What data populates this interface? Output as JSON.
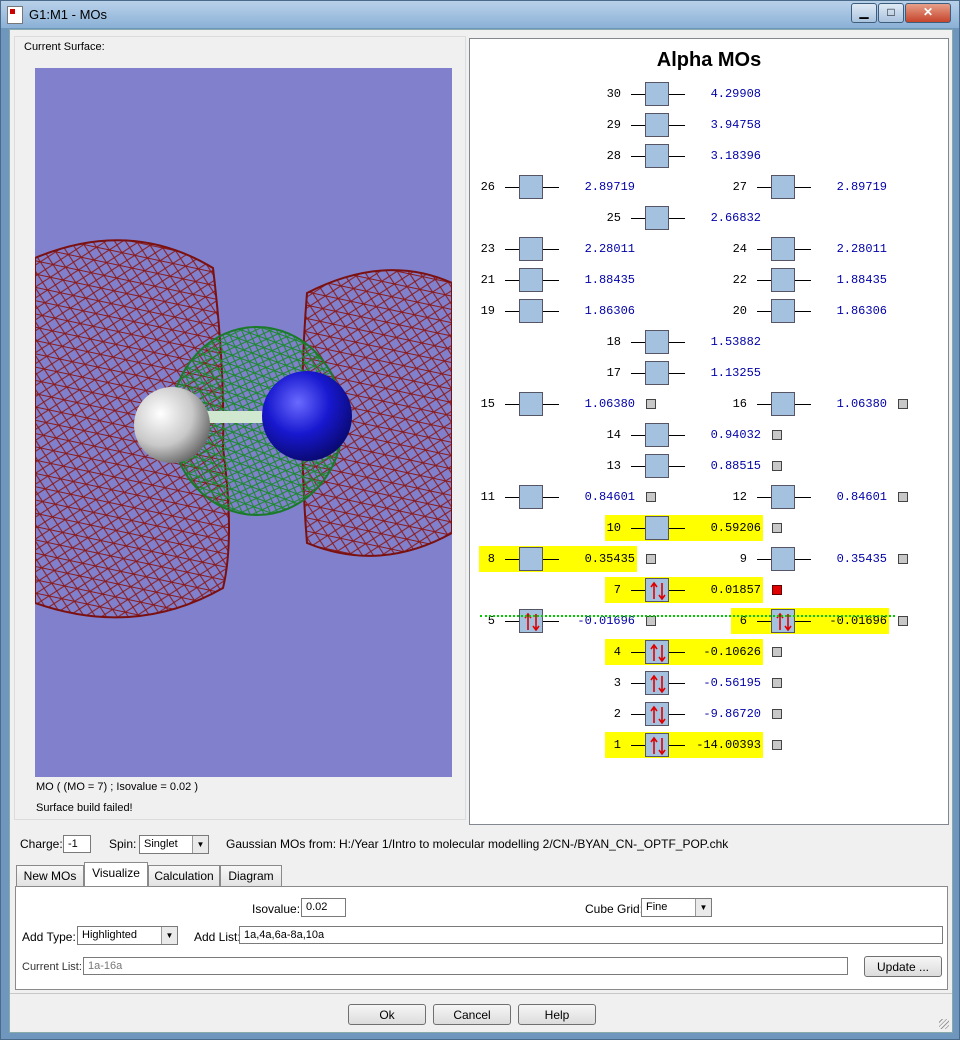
{
  "window": {
    "title": "G1:M1 - MOs",
    "minimize": "▁",
    "maximize": "□",
    "close": "✕"
  },
  "surface": {
    "group_label": "Current Surface:",
    "info": "MO ( (MO = 7) ; Isovalue = 0.02 )",
    "status": "Surface build failed!"
  },
  "diagram": {
    "title": "Alpha MOs",
    "colors": {
      "box": "#a4c2e0",
      "highlight": "#ffff00",
      "energy_text": "#0000aa",
      "selected_square": "#e00000",
      "homo_lumo_line": "#00cc00",
      "electron_arrows": "#e00000"
    },
    "orbitals": [
      {
        "id": "30",
        "energy": "4.29908",
        "highlight": false,
        "occupied": false,
        "square": ""
      },
      {
        "id": "29",
        "energy": "3.94758",
        "highlight": false,
        "occupied": false,
        "square": ""
      },
      {
        "id": "28",
        "energy": "3.18396",
        "highlight": false,
        "occupied": false,
        "square": ""
      },
      {
        "id": "26",
        "energy": "2.89719",
        "highlight": false,
        "occupied": false,
        "square": ""
      },
      {
        "id": "27",
        "energy": "2.89719",
        "highlight": false,
        "occupied": false,
        "square": ""
      },
      {
        "id": "25",
        "energy": "2.66832",
        "highlight": false,
        "occupied": false,
        "square": ""
      },
      {
        "id": "23",
        "energy": "2.28011",
        "highlight": false,
        "occupied": false,
        "square": ""
      },
      {
        "id": "24",
        "energy": "2.28011",
        "highlight": false,
        "occupied": false,
        "square": ""
      },
      {
        "id": "21",
        "energy": "1.88435",
        "highlight": false,
        "occupied": false,
        "square": ""
      },
      {
        "id": "22",
        "energy": "1.88435",
        "highlight": false,
        "occupied": false,
        "square": ""
      },
      {
        "id": "19",
        "energy": "1.86306",
        "highlight": false,
        "occupied": false,
        "square": ""
      },
      {
        "id": "20",
        "energy": "1.86306",
        "highlight": false,
        "occupied": false,
        "square": ""
      },
      {
        "id": "18",
        "energy": "1.53882",
        "highlight": false,
        "occupied": false,
        "square": ""
      },
      {
        "id": "17",
        "energy": "1.13255",
        "highlight": false,
        "occupied": false,
        "square": ""
      },
      {
        "id": "15",
        "energy": "1.06380",
        "highlight": false,
        "occupied": false,
        "square": "grey"
      },
      {
        "id": "16",
        "energy": "1.06380",
        "highlight": false,
        "occupied": false,
        "square": "grey"
      },
      {
        "id": "14",
        "energy": "0.94032",
        "highlight": false,
        "occupied": false,
        "square": "grey"
      },
      {
        "id": "13",
        "energy": "0.88515",
        "highlight": false,
        "occupied": false,
        "square": "grey"
      },
      {
        "id": "11",
        "energy": "0.84601",
        "highlight": false,
        "occupied": false,
        "square": "grey"
      },
      {
        "id": "12",
        "energy": "0.84601",
        "highlight": false,
        "occupied": false,
        "square": "grey"
      },
      {
        "id": "10",
        "energy": "0.59206",
        "highlight": true,
        "occupied": false,
        "square": "grey"
      },
      {
        "id": "8",
        "energy": "0.35435",
        "highlight": true,
        "occupied": false,
        "square": "grey"
      },
      {
        "id": "9",
        "energy": "0.35435",
        "highlight": false,
        "occupied": false,
        "square": "grey"
      },
      {
        "id": "7",
        "energy": "0.01857",
        "highlight": true,
        "occupied": true,
        "square": "red"
      },
      {
        "id": "5",
        "energy": "-0.01696",
        "highlight": false,
        "occupied": true,
        "square": "grey"
      },
      {
        "id": "6",
        "energy": "-0.01696",
        "highlight": true,
        "occupied": true,
        "square": "grey"
      },
      {
        "id": "4",
        "energy": "-0.10626",
        "highlight": true,
        "occupied": true,
        "square": "grey"
      },
      {
        "id": "3",
        "energy": "-0.56195",
        "highlight": false,
        "occupied": true,
        "square": "grey"
      },
      {
        "id": "2",
        "energy": "-9.86720",
        "highlight": false,
        "occupied": true,
        "square": "grey"
      },
      {
        "id": "1",
        "energy": "-14.00393",
        "highlight": true,
        "occupied": true,
        "square": "grey"
      }
    ]
  },
  "controls": {
    "charge_label": "Charge:",
    "charge_value": "-1",
    "spin_label": "Spin:",
    "spin_value": "Singlet",
    "gaussian_label": "Gaussian MOs from:",
    "gaussian_path": "H:/Year 1/Intro to molecular modelling 2/CN-/BYAN_CN-_OPTF_POP.chk"
  },
  "tabs": [
    {
      "label": "New MOs"
    },
    {
      "label": "Visualize"
    },
    {
      "label": "Calculation"
    },
    {
      "label": "Diagram"
    }
  ],
  "visualize": {
    "isovalue_label": "Isovalue:",
    "isovalue": "0.02",
    "cube_grid_label": "Cube Grid:",
    "cube_grid": "Fine",
    "add_type_label": "Add Type:",
    "add_type": "Highlighted",
    "add_list_label": "Add List:",
    "add_list": "1a,4a,6a-8a,10a",
    "current_list_label": "Current List:",
    "current_list": "1a-16a",
    "update_label": "Update ..."
  },
  "buttons": {
    "ok": "Ok",
    "cancel": "Cancel",
    "help": "Help"
  }
}
